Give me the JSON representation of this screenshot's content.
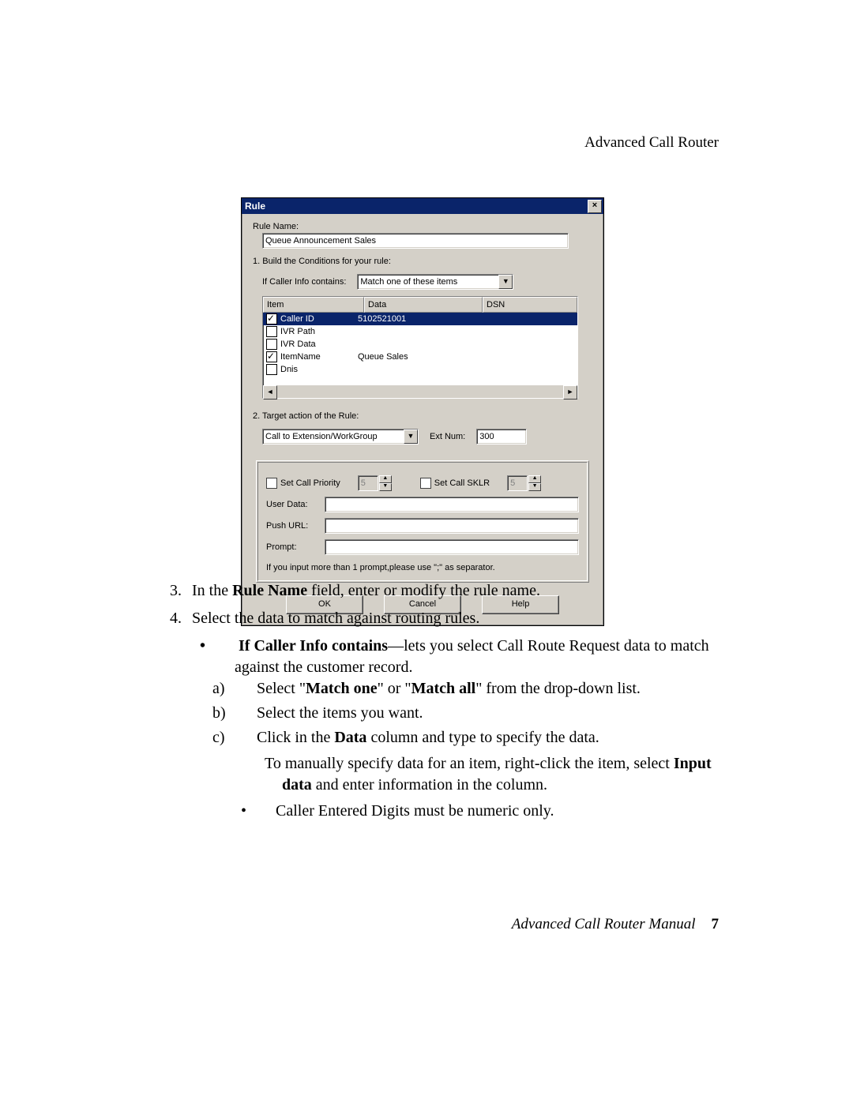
{
  "header": {
    "right": "Advanced Call Router"
  },
  "footer": {
    "title": "Advanced Call Router Manual",
    "page": "7"
  },
  "dialog": {
    "title": "Rule",
    "rule_name_label": "Rule Name:",
    "rule_name_value": "Queue Announcement Sales",
    "cond_header": "1. Build the Conditions for your rule:",
    "cond_if_label": "If Caller Info contains:",
    "cond_match_value": "Match one of these items",
    "list": {
      "columns": [
        "Item",
        "Data",
        "DSN"
      ],
      "rows": [
        {
          "checked": true,
          "selected": true,
          "item": "Caller ID",
          "data": "5102521001",
          "dsn": ""
        },
        {
          "checked": false,
          "selected": false,
          "item": "IVR Path",
          "data": "",
          "dsn": ""
        },
        {
          "checked": false,
          "selected": false,
          "item": "IVR Data",
          "data": "",
          "dsn": ""
        },
        {
          "checked": true,
          "selected": false,
          "item": "ItemName",
          "data": "Queue Sales",
          "dsn": ""
        },
        {
          "checked": false,
          "selected": false,
          "item": "Dnis",
          "data": "",
          "dsn": ""
        }
      ]
    },
    "target_header": "2. Target action of the Rule:",
    "target_action_value": "Call to Extension/WorkGroup",
    "ext_num_label": "Ext Num:",
    "ext_num_value": "300",
    "set_priority_label": "Set Call Priority",
    "set_priority_value": "5",
    "set_sklr_label": "Set Call SKLR",
    "set_sklr_value": "5",
    "user_data_label": "User Data:",
    "push_url_label": "Push URL:",
    "prompt_label": "Prompt:",
    "prompt_note": "If you input more than 1 prompt,please use \";\" as separator.",
    "buttons": {
      "ok": "OK",
      "cancel": "Cancel",
      "help": "Help"
    }
  },
  "body": {
    "step3_num": "3.",
    "step3": "In the Rule Name field, enter or modify the rule name.",
    "step4_num": "4.",
    "step4": "Select the data to match against routing rules.",
    "b1_lead": "If Caller Info contains",
    "b1_rest": "—lets you select Call Route Request data to match against the customer record.",
    "a_num": "a)",
    "a_pre": "Select \"",
    "a_m1": "Match one",
    "a_mid": "\" or \"",
    "a_m2": "Match all",
    "a_post": "\" from the drop-down list.",
    "b_num": "b)",
    "b_txt": "Select the items you want.",
    "c_num": "c)",
    "c_pre": "Click in the ",
    "c_b": "Data",
    "c_post": " column and type to specify the data.",
    "p1_pre": "To manually specify data for an item, right-click the item, select ",
    "p1_b": "Input data",
    "p1_post": " and enter information in the column.",
    "sub1": "Caller Entered Digits must be numeric only."
  }
}
